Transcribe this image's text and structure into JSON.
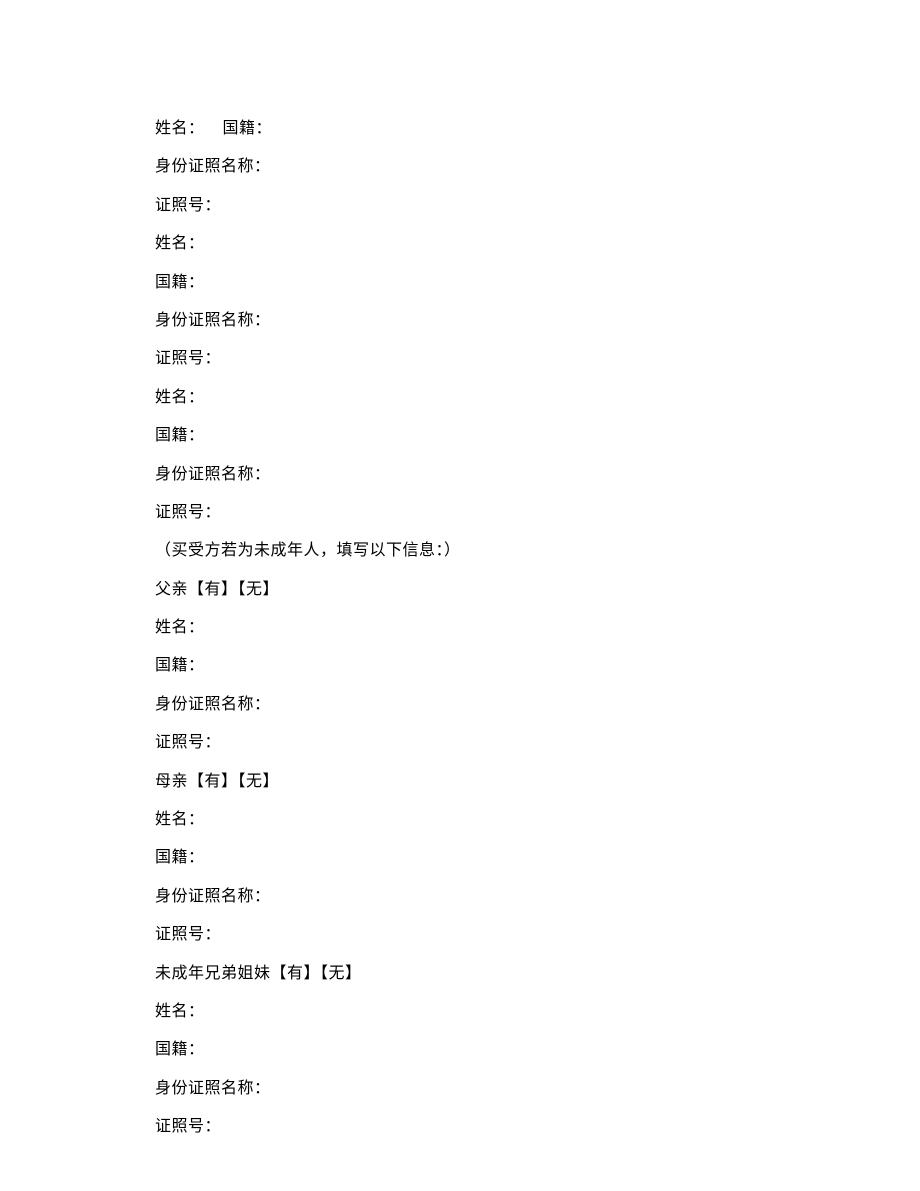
{
  "lines": [
    {
      "type": "combo",
      "parts": [
        "姓名：",
        "国籍："
      ]
    },
    {
      "type": "single",
      "text": "身份证照名称："
    },
    {
      "type": "single",
      "text": "证照号："
    },
    {
      "type": "single",
      "text": "姓名："
    },
    {
      "type": "single",
      "text": "国籍："
    },
    {
      "type": "single",
      "text": "身份证照名称："
    },
    {
      "type": "single",
      "text": "证照号："
    },
    {
      "type": "single",
      "text": "姓名："
    },
    {
      "type": "single",
      "text": "国籍："
    },
    {
      "type": "single",
      "text": "身份证照名称："
    },
    {
      "type": "single",
      "text": "证照号："
    },
    {
      "type": "single",
      "text": "（买受方若为未成年人，填写以下信息：）"
    },
    {
      "type": "single",
      "text": "父亲【有】【无】"
    },
    {
      "type": "single",
      "text": "姓名："
    },
    {
      "type": "single",
      "text": "国籍："
    },
    {
      "type": "single",
      "text": "身份证照名称："
    },
    {
      "type": "single",
      "text": "证照号："
    },
    {
      "type": "single",
      "text": "母亲【有】【无】"
    },
    {
      "type": "single",
      "text": "姓名："
    },
    {
      "type": "single",
      "text": "国籍："
    },
    {
      "type": "single",
      "text": "身份证照名称："
    },
    {
      "type": "single",
      "text": "证照号："
    },
    {
      "type": "single",
      "text": "未成年兄弟姐妹【有】【无】"
    },
    {
      "type": "single",
      "text": "姓名："
    },
    {
      "type": "single",
      "text": "国籍："
    },
    {
      "type": "single",
      "text": "身份证照名称："
    },
    {
      "type": "single",
      "text": "证照号："
    }
  ]
}
